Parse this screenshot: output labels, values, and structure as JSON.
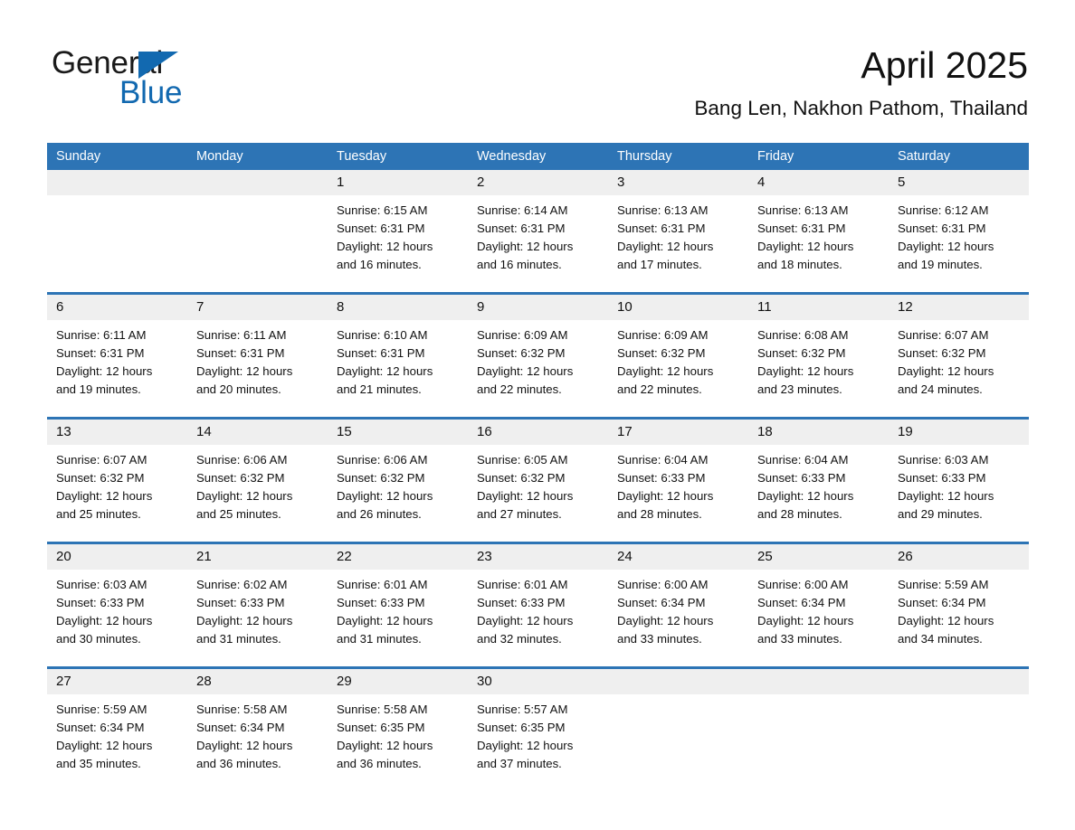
{
  "logo": {
    "word1": "General",
    "word2": "Blue",
    "triangle_color": "#1269b0"
  },
  "header": {
    "month_title": "April 2025",
    "location": "Bang Len, Nakhon Pathom, Thailand"
  },
  "colors": {
    "header_blue": "#2d74b5",
    "row_band_gray": "#efefef",
    "text": "#111111"
  },
  "calendar": {
    "weekdays": [
      "Sunday",
      "Monday",
      "Tuesday",
      "Wednesday",
      "Thursday",
      "Friday",
      "Saturday"
    ],
    "weeks": [
      {
        "days": [
          {
            "num": "",
            "lines": []
          },
          {
            "num": "",
            "lines": []
          },
          {
            "num": "1",
            "lines": [
              "Sunrise: 6:15 AM",
              "Sunset: 6:31 PM",
              "Daylight: 12 hours",
              "and 16 minutes."
            ]
          },
          {
            "num": "2",
            "lines": [
              "Sunrise: 6:14 AM",
              "Sunset: 6:31 PM",
              "Daylight: 12 hours",
              "and 16 minutes."
            ]
          },
          {
            "num": "3",
            "lines": [
              "Sunrise: 6:13 AM",
              "Sunset: 6:31 PM",
              "Daylight: 12 hours",
              "and 17 minutes."
            ]
          },
          {
            "num": "4",
            "lines": [
              "Sunrise: 6:13 AM",
              "Sunset: 6:31 PM",
              "Daylight: 12 hours",
              "and 18 minutes."
            ]
          },
          {
            "num": "5",
            "lines": [
              "Sunrise: 6:12 AM",
              "Sunset: 6:31 PM",
              "Daylight: 12 hours",
              "and 19 minutes."
            ]
          }
        ]
      },
      {
        "days": [
          {
            "num": "6",
            "lines": [
              "Sunrise: 6:11 AM",
              "Sunset: 6:31 PM",
              "Daylight: 12 hours",
              "and 19 minutes."
            ]
          },
          {
            "num": "7",
            "lines": [
              "Sunrise: 6:11 AM",
              "Sunset: 6:31 PM",
              "Daylight: 12 hours",
              "and 20 minutes."
            ]
          },
          {
            "num": "8",
            "lines": [
              "Sunrise: 6:10 AM",
              "Sunset: 6:31 PM",
              "Daylight: 12 hours",
              "and 21 minutes."
            ]
          },
          {
            "num": "9",
            "lines": [
              "Sunrise: 6:09 AM",
              "Sunset: 6:32 PM",
              "Daylight: 12 hours",
              "and 22 minutes."
            ]
          },
          {
            "num": "10",
            "lines": [
              "Sunrise: 6:09 AM",
              "Sunset: 6:32 PM",
              "Daylight: 12 hours",
              "and 22 minutes."
            ]
          },
          {
            "num": "11",
            "lines": [
              "Sunrise: 6:08 AM",
              "Sunset: 6:32 PM",
              "Daylight: 12 hours",
              "and 23 minutes."
            ]
          },
          {
            "num": "12",
            "lines": [
              "Sunrise: 6:07 AM",
              "Sunset: 6:32 PM",
              "Daylight: 12 hours",
              "and 24 minutes."
            ]
          }
        ]
      },
      {
        "days": [
          {
            "num": "13",
            "lines": [
              "Sunrise: 6:07 AM",
              "Sunset: 6:32 PM",
              "Daylight: 12 hours",
              "and 25 minutes."
            ]
          },
          {
            "num": "14",
            "lines": [
              "Sunrise: 6:06 AM",
              "Sunset: 6:32 PM",
              "Daylight: 12 hours",
              "and 25 minutes."
            ]
          },
          {
            "num": "15",
            "lines": [
              "Sunrise: 6:06 AM",
              "Sunset: 6:32 PM",
              "Daylight: 12 hours",
              "and 26 minutes."
            ]
          },
          {
            "num": "16",
            "lines": [
              "Sunrise: 6:05 AM",
              "Sunset: 6:32 PM",
              "Daylight: 12 hours",
              "and 27 minutes."
            ]
          },
          {
            "num": "17",
            "lines": [
              "Sunrise: 6:04 AM",
              "Sunset: 6:33 PM",
              "Daylight: 12 hours",
              "and 28 minutes."
            ]
          },
          {
            "num": "18",
            "lines": [
              "Sunrise: 6:04 AM",
              "Sunset: 6:33 PM",
              "Daylight: 12 hours",
              "and 28 minutes."
            ]
          },
          {
            "num": "19",
            "lines": [
              "Sunrise: 6:03 AM",
              "Sunset: 6:33 PM",
              "Daylight: 12 hours",
              "and 29 minutes."
            ]
          }
        ]
      },
      {
        "days": [
          {
            "num": "20",
            "lines": [
              "Sunrise: 6:03 AM",
              "Sunset: 6:33 PM",
              "Daylight: 12 hours",
              "and 30 minutes."
            ]
          },
          {
            "num": "21",
            "lines": [
              "Sunrise: 6:02 AM",
              "Sunset: 6:33 PM",
              "Daylight: 12 hours",
              "and 31 minutes."
            ]
          },
          {
            "num": "22",
            "lines": [
              "Sunrise: 6:01 AM",
              "Sunset: 6:33 PM",
              "Daylight: 12 hours",
              "and 31 minutes."
            ]
          },
          {
            "num": "23",
            "lines": [
              "Sunrise: 6:01 AM",
              "Sunset: 6:33 PM",
              "Daylight: 12 hours",
              "and 32 minutes."
            ]
          },
          {
            "num": "24",
            "lines": [
              "Sunrise: 6:00 AM",
              "Sunset: 6:34 PM",
              "Daylight: 12 hours",
              "and 33 minutes."
            ]
          },
          {
            "num": "25",
            "lines": [
              "Sunrise: 6:00 AM",
              "Sunset: 6:34 PM",
              "Daylight: 12 hours",
              "and 33 minutes."
            ]
          },
          {
            "num": "26",
            "lines": [
              "Sunrise: 5:59 AM",
              "Sunset: 6:34 PM",
              "Daylight: 12 hours",
              "and 34 minutes."
            ]
          }
        ]
      },
      {
        "days": [
          {
            "num": "27",
            "lines": [
              "Sunrise: 5:59 AM",
              "Sunset: 6:34 PM",
              "Daylight: 12 hours",
              "and 35 minutes."
            ]
          },
          {
            "num": "28",
            "lines": [
              "Sunrise: 5:58 AM",
              "Sunset: 6:34 PM",
              "Daylight: 12 hours",
              "and 36 minutes."
            ]
          },
          {
            "num": "29",
            "lines": [
              "Sunrise: 5:58 AM",
              "Sunset: 6:35 PM",
              "Daylight: 12 hours",
              "and 36 minutes."
            ]
          },
          {
            "num": "30",
            "lines": [
              "Sunrise: 5:57 AM",
              "Sunset: 6:35 PM",
              "Daylight: 12 hours",
              "and 37 minutes."
            ]
          },
          {
            "num": "",
            "lines": []
          },
          {
            "num": "",
            "lines": []
          },
          {
            "num": "",
            "lines": []
          }
        ]
      }
    ]
  }
}
